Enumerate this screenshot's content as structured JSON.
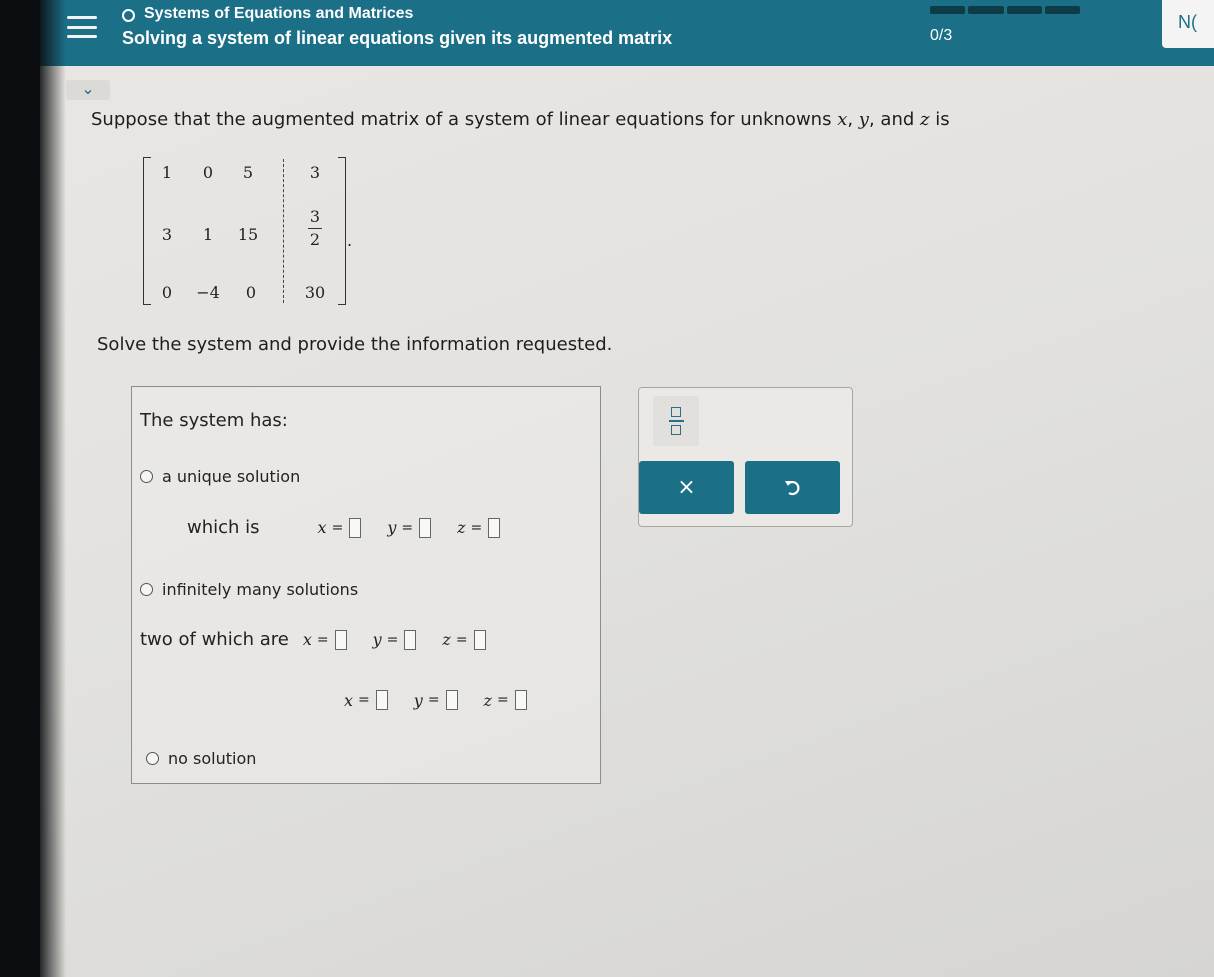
{
  "header": {
    "topic": "Systems of Equations and Matrices",
    "title": "Solving a system of linear equations given its augmented matrix",
    "score": "0/3",
    "right_text": "N(",
    "progress_segments": 4
  },
  "question": {
    "intro": "Suppose that the augmented matrix of a system of linear equations for unknowns ",
    "vars": [
      "x",
      "y",
      "z"
    ],
    "sep1": ", ",
    "sep2": ", and ",
    "tail": " is",
    "instruction": "Solve the system and provide the information requested."
  },
  "matrix": {
    "r1": [
      "1",
      "0",
      "5",
      "3"
    ],
    "r2": [
      "3",
      "1",
      "15"
    ],
    "r2_frac": {
      "num": "3",
      "den": "2"
    },
    "r3": [
      "0",
      "−4",
      "0",
      "30"
    ],
    "end": "."
  },
  "answer": {
    "heading": "The system has:",
    "unique_label": "a unique solution",
    "which_is": "which is",
    "infinite_label": "infinitely many solutions",
    "two_of_which": "two of which are",
    "no_solution_label": "no solution",
    "x": "x",
    "y": "y",
    "z": "z",
    "eq": "="
  },
  "tools": {
    "fraction_icon": "fraction-icon",
    "clear_label": "×",
    "undo_icon": "undo-icon"
  },
  "colors": {
    "header": "#1b6f86",
    "button": "#1b6f86"
  }
}
